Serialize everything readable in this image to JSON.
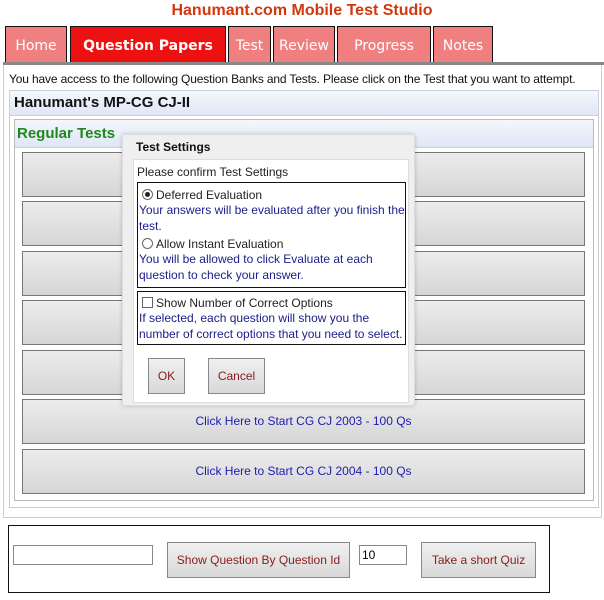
{
  "site_title": "Hanumant.com Mobile Test Studio",
  "tabs": [
    {
      "label": "Home",
      "active": false
    },
    {
      "label": "Question Papers",
      "active": true
    },
    {
      "label": "Test",
      "active": false
    },
    {
      "label": "Review",
      "active": false
    },
    {
      "label": "Progress",
      "active": false
    },
    {
      "label": "Notes",
      "active": false
    }
  ],
  "intro": "You have access to the following Question Banks and Tests. Please click on the Test that you want to attempt.",
  "bank": {
    "title": "Hanumant's MP-CG CJ-II",
    "category": "Regular Tests",
    "tests": [
      {
        "label": ""
      },
      {
        "label": ""
      },
      {
        "label": ""
      },
      {
        "label": ""
      },
      {
        "label": ""
      },
      {
        "label": "Click Here to Start CG CJ 2003 - 100 Qs"
      },
      {
        "label": "Click Here to Start CG CJ 2004 - 100 Qs"
      }
    ]
  },
  "dialog": {
    "title": "Test Settings",
    "subtitle": "Please confirm Test Settings",
    "deferred": {
      "label": "Deferred Evaluation",
      "checked": true,
      "desc": "Your answers will be evaluated after you finish the test."
    },
    "instant": {
      "label": "Allow Instant Evaluation",
      "checked": false,
      "desc": "You will be allowed to click Evaluate at each question to check your answer."
    },
    "show_correct": {
      "label": "Show Number of Correct Options",
      "checked": false,
      "desc": "If selected, each question will show you the number of correct options that you need to select."
    },
    "ok_label": "OK",
    "cancel_label": "Cancel"
  },
  "quiz": {
    "question_id_value": "",
    "show_by_id_label": "Show Question By Question Id",
    "count_value": "10",
    "short_quiz_label": "Take a short Quiz"
  }
}
